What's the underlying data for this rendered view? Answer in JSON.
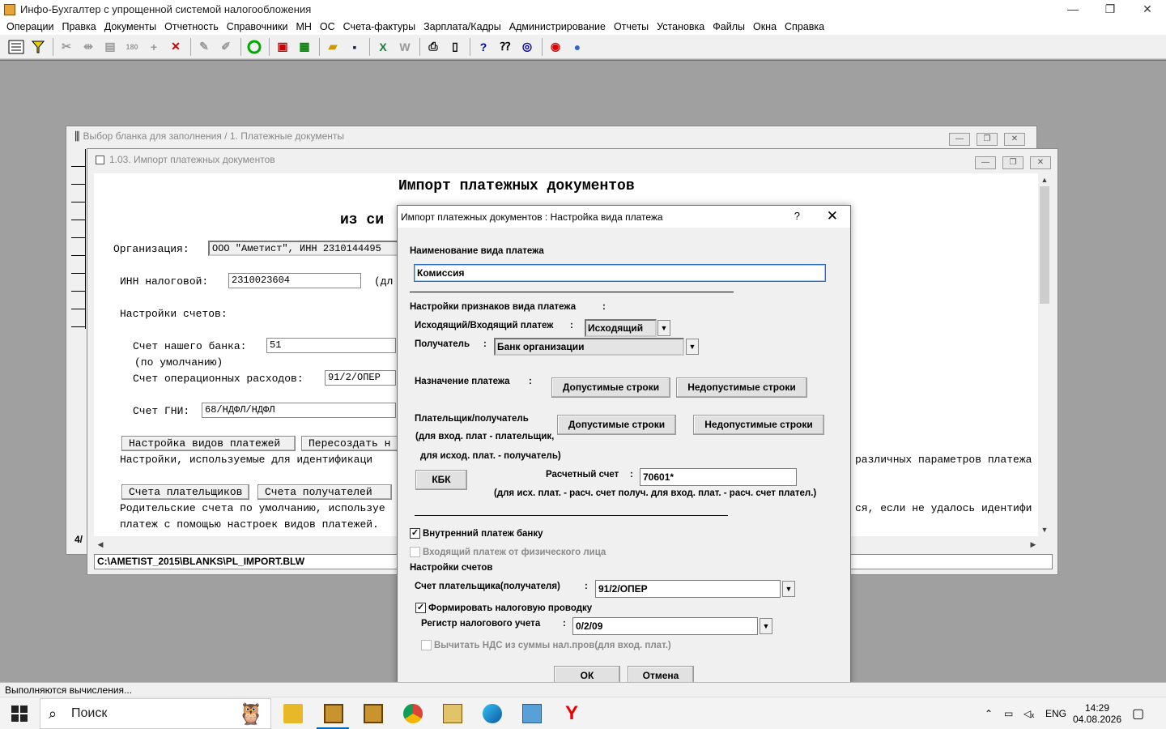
{
  "app": {
    "title": "Инфо-Бухгалтер с упрощенной системой налогообложения",
    "win_min": "—",
    "win_max": "❐",
    "win_close": "✕"
  },
  "menu": [
    "Операции",
    "Правка",
    "Документы",
    "Отчетность",
    "Справочники",
    "МН",
    "ОС",
    "Счета-фактуры",
    "Зарплата/Кадры",
    "Администрирование",
    "Отчеты",
    "Установка",
    "Файлы",
    "Окна",
    "Справка"
  ],
  "bg_window": {
    "title": "Выбор бланка для заполнения /    1. Платежные документы"
  },
  "import_window": {
    "title": "1.03. Импорт платежных документов",
    "heading": "Импорт платежных документов",
    "subheading": "из си",
    "org_label": "Организация:",
    "org_value": "ООО \"Аметист\", ИНН 2310144495",
    "inn_label": "ИНН налоговой:",
    "inn_value": "2310023604",
    "inn_suffix": "(дл",
    "accounts_label": "Настройки счетов:",
    "bank_acc_label": "Счет нашего банка:",
    "bank_acc_value": "51",
    "default_note": "(по умолчанию)",
    "oper_label": "Счет операционных расходов:",
    "oper_value": "91/2/ОПЕР",
    "gni_label": "Счет ГНИ:",
    "gni_value": "68/НДФЛ/НДФЛ",
    "btn_payment_types": "Настройка видов платежей",
    "btn_recreate": "Пересоздать н",
    "settings_note": "Настройки, используемые для идентификаци",
    "settings_note_right": "различных параметров платежа",
    "btn_payers": "Счета плательщиков",
    "btn_receivers": "Счета получателей",
    "parent_note": "Родительские счета по умолчанию, используе",
    "parent_note_right": "ся, если не удалось идентифи",
    "parent_note2": "платеж с помощью настроек видов платежей.",
    "left_marker": "4/",
    "path": "C:\\AMETIST_2015\\BLANKS\\PL_IMPORT.BLW"
  },
  "dialog": {
    "title": "Импорт платежных документов : Настройка вида платежа",
    "help": "?",
    "close": "✕",
    "name_label": "Наименование вида платежа",
    "name_value": "Комиссия",
    "signs_label": "Настройки признаков вида платежа",
    "colon": ":",
    "direction_label": "Исходящий/Входящий платеж",
    "direction_value": "Исходящий",
    "receiver_label": "Получатель",
    "receiver_value": "Банк организации",
    "purpose_label": "Назначение платежа",
    "btn_allowed": "Допустимые строки",
    "btn_disallowed": "Недопустимые строки",
    "payer_label": "Плательщик/получатель",
    "payer_note1": "(для вход. плат - плательщик,",
    "payer_note2": "для исход. плат. - получатель)",
    "btn_kbk": "КБК",
    "account_label": "Расчетный счет",
    "account_value": "70601*",
    "account_note": "(для исх. плат. - расч. счет получ. для вход. плат. - расч. счет плател.)",
    "internal_label": "Внутренний платеж банку",
    "internal_checked": true,
    "incoming_person_label": "Входящий платеж от физического лица",
    "accounts_settings_label": "Настройки счетов",
    "payer_acc_label": "Счет плательщика(получателя)",
    "payer_acc_value": "91/2/ОПЕР",
    "tax_posting_label": "Формировать налоговую проводку",
    "tax_posting_checked": true,
    "register_label": "Регистр налогового учета",
    "register_value": "0/2/09",
    "vat_label": "Вычитать НДС из суммы нал.пров(для вход. плат.)",
    "ok": "ОК",
    "cancel": "Отмена"
  },
  "status": {
    "text": "Выполняются вычисления..."
  },
  "taskbar": {
    "search_placeholder": "Поиск",
    "lang": "ENG",
    "time": "14:29",
    "date": "04.08.2026"
  },
  "colors": {
    "mdi_bg": "#a0a0a0",
    "focus": "#2a6ec7",
    "taskbar_active": "#0067c0"
  }
}
